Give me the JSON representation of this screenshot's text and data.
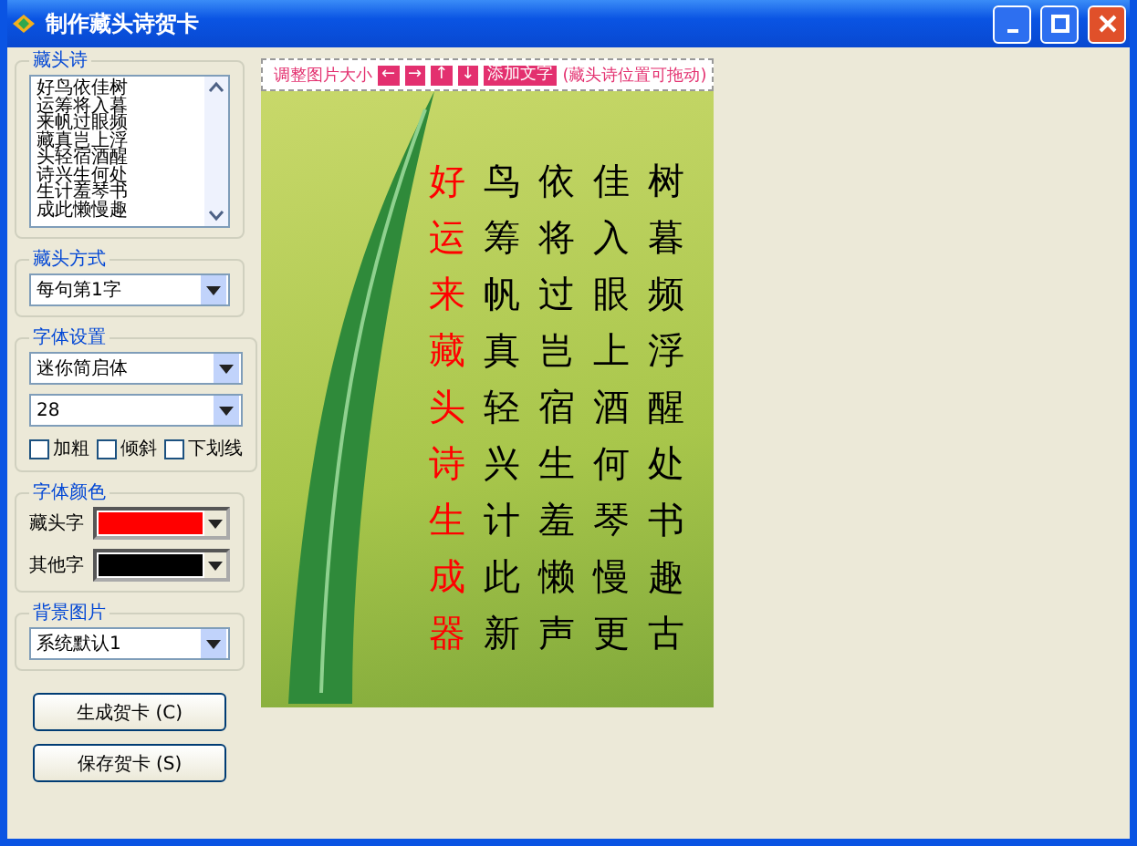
{
  "window": {
    "title": "制作藏头诗贺卡"
  },
  "poem_group": {
    "label": "藏头诗",
    "lines": [
      "好鸟依佳树",
      "运筹将入暮",
      "来帆过眼频",
      "藏真岂上浮",
      "头轻宿酒醒",
      "诗兴生何处",
      "生计羞琴书",
      "成此懒慢趣"
    ]
  },
  "mode_group": {
    "label": "藏头方式",
    "value": "每句第1字"
  },
  "font_group": {
    "label": "字体设置",
    "family": "迷你简启体",
    "size": "28",
    "options": [
      {
        "label": "加粗",
        "checked": false
      },
      {
        "label": "倾斜",
        "checked": false
      },
      {
        "label": "下划线",
        "checked": false
      }
    ]
  },
  "color_group": {
    "label": "字体颜色",
    "rows": [
      {
        "label": "藏头字",
        "color": "#ff0000"
      },
      {
        "label": "其他字",
        "color": "#000000"
      }
    ]
  },
  "background_group": {
    "label": "背景图片",
    "value": "系统默认1"
  },
  "buttons": [
    "生成贺卡 (C)",
    "保存贺卡 (S)"
  ],
  "toolbar": {
    "label": "调整图片大小",
    "arrows": [
      "←",
      "→",
      "↑",
      "↓"
    ],
    "add_button": "添加文字",
    "hint": "(藏头诗位置可拖动)"
  },
  "card": {
    "lines": [
      {
        "head": "好",
        "rest": "鸟依佳树"
      },
      {
        "head": "运",
        "rest": "筹将入暮"
      },
      {
        "head": "来",
        "rest": "帆过眼频"
      },
      {
        "head": "藏",
        "rest": "真岂上浮"
      },
      {
        "head": "头",
        "rest": "轻宿酒醒"
      },
      {
        "head": "诗",
        "rest": "兴生何处"
      },
      {
        "head": "生",
        "rest": "计羞琴书"
      },
      {
        "head": "成",
        "rest": "此懒慢趣"
      },
      {
        "head": "器",
        "rest": "新声更古"
      }
    ]
  }
}
